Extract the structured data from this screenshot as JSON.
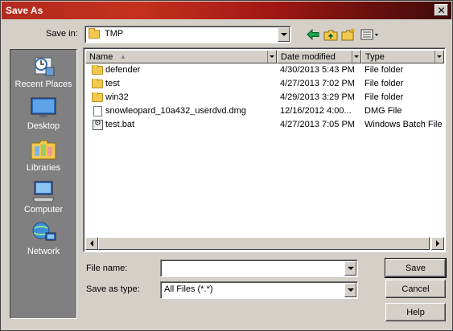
{
  "window": {
    "title": "Save As"
  },
  "toolbar": {
    "save_in_label": "Save in:",
    "location": "TMP",
    "icons": [
      "back-arrow-icon",
      "up-folder-icon",
      "new-folder-icon",
      "view-menu-icon"
    ]
  },
  "places": [
    {
      "label": "Recent Places",
      "icon": "recent-places-icon"
    },
    {
      "label": "Desktop",
      "icon": "desktop-icon"
    },
    {
      "label": "Libraries",
      "icon": "libraries-icon"
    },
    {
      "label": "Computer",
      "icon": "computer-icon"
    },
    {
      "label": "Network",
      "icon": "network-icon"
    }
  ],
  "file_list": {
    "columns": [
      "Name",
      "Date modified",
      "Type"
    ],
    "rows": [
      {
        "name": "defender",
        "date": "4/30/2013 5:43 PM",
        "type": "File folder",
        "icon": "folder-icon"
      },
      {
        "name": "test",
        "date": "4/27/2013 7:02 PM",
        "type": "File folder",
        "icon": "folder-icon"
      },
      {
        "name": "win32",
        "date": "4/29/2013 3:29 PM",
        "type": "File folder",
        "icon": "folder-icon"
      },
      {
        "name": "snowleopard_10a432_userdvd.dmg",
        "date": "12/16/2012 4:00...",
        "type": "DMG File",
        "icon": "file-icon"
      },
      {
        "name": "test.bat",
        "date": "4/27/2013 7:05 PM",
        "type": "Windows Batch File",
        "icon": "batch-file-icon"
      }
    ]
  },
  "form": {
    "file_name_label": "File name:",
    "file_name_value": "",
    "save_as_type_label": "Save as type:",
    "save_as_type_value": "All Files (*.*)"
  },
  "buttons": {
    "save": "Save",
    "cancel": "Cancel",
    "help": "Help"
  },
  "colors": {
    "titlebar": "#b32a1e",
    "dialog_bg": "#d4d0c8",
    "places_bg": "#808080"
  }
}
